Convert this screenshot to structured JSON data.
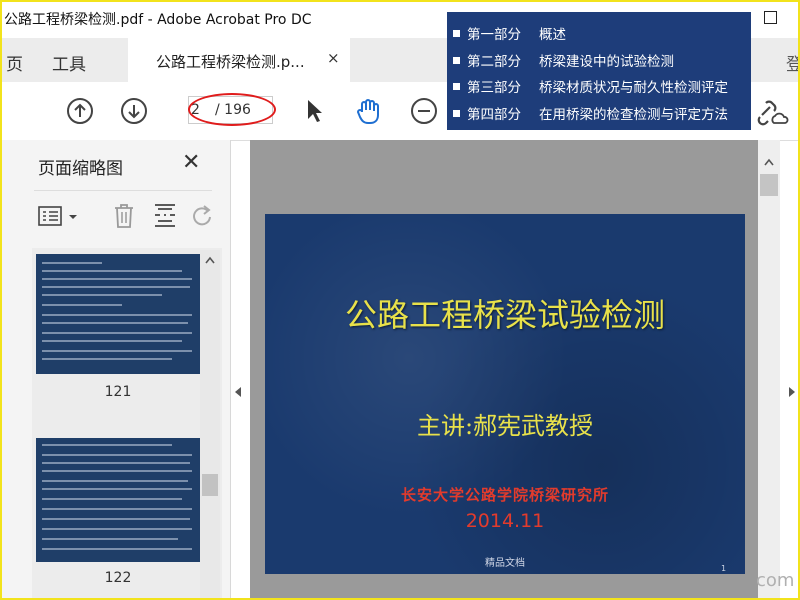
{
  "window": {
    "title": "公路工程桥梁检测.pdf - Adobe Acrobat Pro DC"
  },
  "tabs": {
    "left_partial": "页",
    "tools": "工具",
    "doc_tab": "公路工程桥梁检测.p...",
    "close_glyph": "×",
    "right_partial": "登"
  },
  "toolbar": {
    "page_current": "2",
    "page_total": "/ 196",
    "icons": [
      "up-arrow-icon",
      "down-arrow-icon",
      "select-cursor-icon",
      "hand-tool-icon",
      "zoom-out-icon",
      "link-cloud-icon"
    ]
  },
  "toc": {
    "items": [
      {
        "part": "第一部分",
        "title": "概述"
      },
      {
        "part": "第二部分",
        "title": "桥梁建设中的试验检测"
      },
      {
        "part": "第三部分",
        "title": "桥梁材质状况与耐久性检测评定"
      },
      {
        "part": "第四部分",
        "title": "在用桥梁的检查检测与评定方法"
      }
    ]
  },
  "sidebar": {
    "title": "页面缩略图",
    "close_glyph": "✕",
    "thumbnails": [
      {
        "page": "121"
      },
      {
        "page": "122"
      }
    ]
  },
  "slide": {
    "title": "公路工程桥梁试验检测",
    "speaker": "主讲:郝宪武教授",
    "institution": "长安大学公路学院桥梁研究所",
    "date": "2014.11",
    "footer": "精品文档",
    "page_number": "1"
  },
  "watermark": "com",
  "colors": {
    "toc_bg": "#1e3d7a",
    "slide_bg": "#1a3a6e",
    "slide_title": "#e8e14a",
    "slide_red": "#e33b2c",
    "highlight_oval": "#e01c1c",
    "frame": "#f2e31c"
  }
}
